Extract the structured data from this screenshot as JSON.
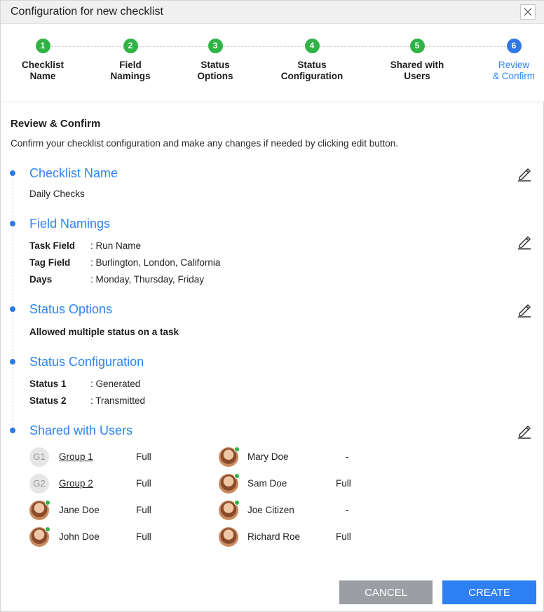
{
  "dialog": {
    "title": "Configuration for new checklist"
  },
  "steps": [
    {
      "num": "1",
      "label": "Checklist Name"
    },
    {
      "num": "2",
      "label": "Field Namings"
    },
    {
      "num": "3",
      "label": "Status Options"
    },
    {
      "num": "4",
      "label": "Status Configuration"
    },
    {
      "num": "5",
      "label": "Shared with Users"
    },
    {
      "num": "6",
      "label": "Review & Confirm"
    }
  ],
  "review": {
    "heading": "Review & Confirm",
    "description": "Confirm your checklist configuration and make any changes if needed by clicking edit button."
  },
  "checklist_name": {
    "title": "Checklist Name",
    "value": "Daily Checks"
  },
  "field_namings": {
    "title": "Field Namings",
    "rows": [
      {
        "key": "Task Field",
        "value": ": Run Name"
      },
      {
        "key": "Tag Field",
        "value": ": Burlington, London, California"
      },
      {
        "key": "Days",
        "value": ": Monday, Thursday, Friday"
      }
    ]
  },
  "status_options": {
    "title": "Status Options",
    "value": "Allowed multiple status on a task"
  },
  "status_configuration": {
    "title": "Status Configuration",
    "rows": [
      {
        "key": "Status 1",
        "value": ": Generated"
      },
      {
        "key": "Status 2",
        "value": ": Transmitted"
      }
    ]
  },
  "shared_users": {
    "title": "Shared with Users",
    "left": [
      {
        "initials": "G1",
        "name": "Group 1",
        "permission": "Full"
      },
      {
        "initials": "G2",
        "name": "Group 2",
        "permission": "Full"
      },
      {
        "name": "Jane Doe",
        "permission": "Full"
      },
      {
        "name": "John Doe",
        "permission": "Full"
      }
    ],
    "right": [
      {
        "name": "Mary Doe",
        "permission": "-"
      },
      {
        "name": "Sam Doe",
        "permission": "Full"
      },
      {
        "name": "Joe Citizen",
        "permission": "-"
      },
      {
        "name": "Richard Roe",
        "permission": "Full"
      }
    ]
  },
  "buttons": {
    "cancel": "CANCEL",
    "create": "CREATE"
  },
  "colors": {
    "accent": "#2e84f0",
    "done": "#2fb344",
    "cancel_bg": "#9b9fa4"
  }
}
